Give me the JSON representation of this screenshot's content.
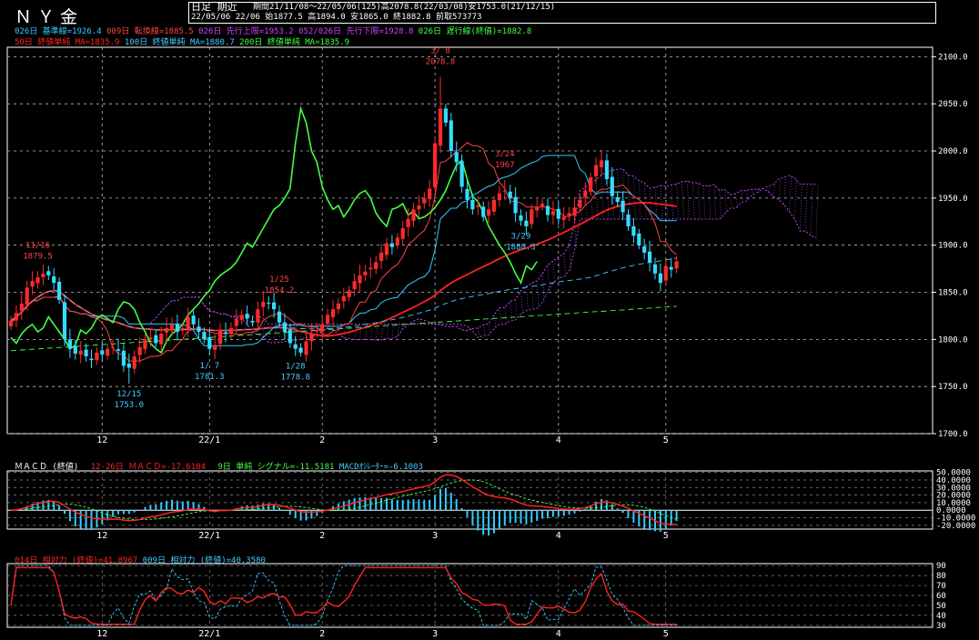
{
  "header": {
    "title": "ＮＹ金",
    "mode": "日足 期近",
    "period_line": "期間21/11/08～22/05/06(125)高2078.8(22/03/08)安1753.0(21/12/15)",
    "last_line": "22/05/06 22/06 始1877.5 高1894.0 安1865.0 終1882.8 前取573773",
    "colors": {
      "background": "#000000",
      "frame": "#ffffff"
    }
  },
  "legend_row1": [
    {
      "text": "026日 基準線=1926.4",
      "color": "#33ccff"
    },
    {
      "text": "009日 転換線=1885.5",
      "color": "#ff4444"
    },
    {
      "text": "026日 先行上限=1953.2",
      "color": "#cc44ff"
    },
    {
      "text": "052/026日 先行下限=1928.8",
      "color": "#cc44ff"
    },
    {
      "text": "026日 遅行線(終値)=1882.8",
      "color": "#44ff44"
    }
  ],
  "legend_row2": [
    {
      "text": "50日 終値単純 MA=1835.9",
      "color": "#ff2222"
    },
    {
      "text": "100日 終値単純 MA=1880.7",
      "color": "#44ccff"
    },
    {
      "text": "200日 終値単純 MA=1835.9",
      "color": "#44ff44"
    }
  ],
  "chart_data": [
    {
      "type": "candlestick",
      "panel": "price",
      "ylim": [
        1700,
        2110
      ],
      "yticks": [
        1700,
        1750,
        1800,
        1850,
        1900,
        1950,
        2000,
        2050,
        2100
      ],
      "ytick_labels": [
        "1700.0",
        "1750.0",
        "1800.0",
        "1850.0",
        "1900.0",
        "1950.0",
        "2000.0",
        "2050.0",
        "2100.0"
      ],
      "xtick_labels": [
        "12",
        "22/1",
        "2",
        "3",
        "4",
        "5"
      ],
      "xtick_bar_index": [
        17,
        37,
        58,
        79,
        102,
        122
      ],
      "bars_total": 125,
      "closes": [
        1820,
        1828,
        1838,
        1855,
        1862,
        1866,
        1870,
        1868,
        1860,
        1842,
        1800,
        1790,
        1785,
        1788,
        1782,
        1778,
        1786,
        1784,
        1790,
        1792,
        1788,
        1772,
        1770,
        1782,
        1792,
        1800,
        1802,
        1796,
        1806,
        1812,
        1816,
        1808,
        1812,
        1824,
        1816,
        1808,
        1800,
        1790,
        1794,
        1810,
        1806,
        1812,
        1822,
        1826,
        1822,
        1818,
        1832,
        1840,
        1838,
        1832,
        1818,
        1808,
        1796,
        1790,
        1786,
        1798,
        1806,
        1810,
        1816,
        1826,
        1832,
        1838,
        1846,
        1852,
        1862,
        1868,
        1872,
        1876,
        1882,
        1892,
        1902,
        1898,
        1908,
        1918,
        1928,
        1938,
        1942,
        1950,
        1960,
        2008,
        2045,
        2030,
        2000,
        1988,
        1962,
        1948,
        1938,
        1942,
        1930,
        1938,
        1948,
        1955,
        1958,
        1950,
        1934,
        1926,
        1920,
        1938,
        1940,
        1944,
        1932,
        1936,
        1928,
        1930,
        1934,
        1940,
        1948,
        1958,
        1972,
        1985,
        1990,
        1970,
        1952,
        1946,
        1935,
        1920,
        1910,
        1900,
        1892,
        1882,
        1870,
        1860,
        1878,
        1874,
        1882.8
      ],
      "high": 2078.8,
      "low": 1753.0,
      "annotations": [
        {
          "text": "11/16",
          "color": "#ff4444",
          "bar": 5
        },
        {
          "text": "1879.5",
          "color": "#ff4444",
          "bar": 5
        },
        {
          "text": "12/15",
          "color": "#44ccff",
          "bar": 22
        },
        {
          "text": "1753.0",
          "color": "#44ccff",
          "bar": 22
        },
        {
          "text": "1/ 7",
          "color": "#44ccff",
          "bar": 37
        },
        {
          "text": "1781.3",
          "color": "#44ccff",
          "bar": 37
        },
        {
          "text": "1/25",
          "color": "#ff4444",
          "bar": 50
        },
        {
          "text": "1854.2",
          "color": "#ff4444",
          "bar": 50
        },
        {
          "text": "1/28",
          "color": "#44ccff",
          "bar": 53
        },
        {
          "text": "1778.8",
          "color": "#44ccff",
          "bar": 53
        },
        {
          "text": "3/ 8",
          "color": "#ff4444",
          "bar": 80
        },
        {
          "text": "2078.8",
          "color": "#ff4444",
          "bar": 80
        },
        {
          "text": "3/24",
          "color": "#ff4444",
          "bar": 92
        },
        {
          "text": "1967",
          "color": "#ff4444",
          "bar": 92
        },
        {
          "text": "3/29",
          "color": "#44ccff",
          "bar": 95
        },
        {
          "text": "1888.3",
          "color": "#44ccff",
          "bar": 95
        }
      ]
    },
    {
      "type": "line",
      "panel": "macd",
      "title": "ＭＡＣＤ (終値)",
      "legend": [
        {
          "text": "12-26日 ＭＡＣＤ=-17.6184",
          "color": "#ff2222"
        },
        {
          "text": "9日 単純 シグナル=-11.5181",
          "color": "#44ff44"
        },
        {
          "text": "MACDｵｼﾚｰﾀｰ=-6.1003",
          "color": "#44ccff"
        }
      ],
      "ylim": [
        -25,
        52
      ],
      "yticks": [
        -20,
        -10,
        0,
        10,
        20,
        30,
        40,
        50
      ],
      "ytick_labels": [
        "-20.0000",
        "-10.0000",
        "0.0000",
        "10.0000",
        "20.0000",
        "30.0000",
        "40.0000",
        "50.0000"
      ],
      "xtick_labels": [
        "12",
        "22/1",
        "2",
        "3",
        "4",
        "5"
      ]
    },
    {
      "type": "line",
      "panel": "rsi",
      "legend": [
        {
          "text": "014日 相対力 (終値)=41.8967",
          "color": "#ff2222"
        },
        {
          "text": "009日 相対力 (終値)=40.3580",
          "color": "#44ccff"
        }
      ],
      "ylim": [
        28,
        92
      ],
      "yticks": [
        30,
        40,
        50,
        60,
        70,
        80,
        90
      ],
      "ytick_labels": [
        "30",
        "40",
        "50",
        "60",
        "70",
        "80",
        "90"
      ],
      "xtick_labels": [
        "12",
        "22/1",
        "2",
        "3",
        "4",
        "5"
      ]
    }
  ]
}
